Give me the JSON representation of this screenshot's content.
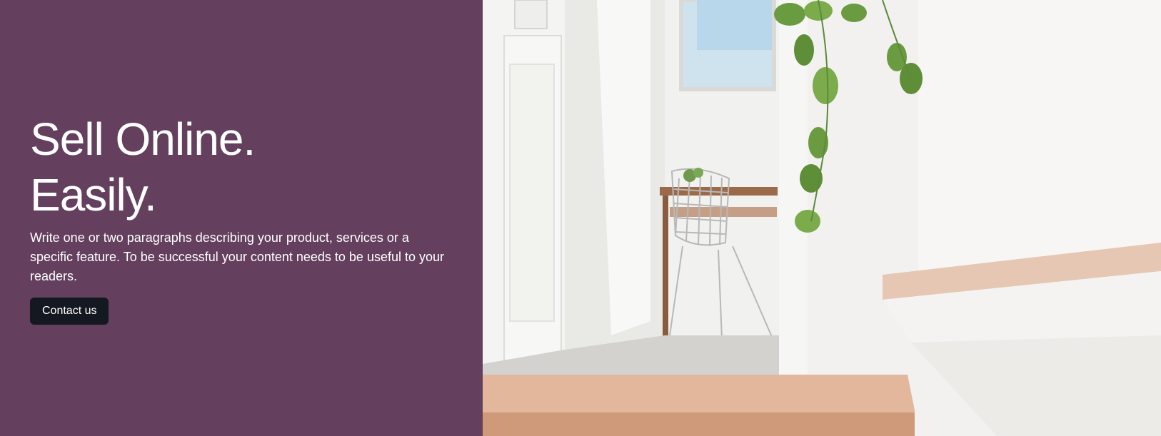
{
  "hero": {
    "headline_line1": "Sell Online.",
    "headline_line2": "Easily.",
    "paragraph": "Write one or two paragraphs describing your product, services or a specific feature. To be successful your content needs to be useful to your readers.",
    "cta_label": "Contact us"
  },
  "colors": {
    "panel_background": "#64405e",
    "button_background": "#141821",
    "text": "#ffffff"
  },
  "image": {
    "subject": "interior-hallway-photo"
  }
}
